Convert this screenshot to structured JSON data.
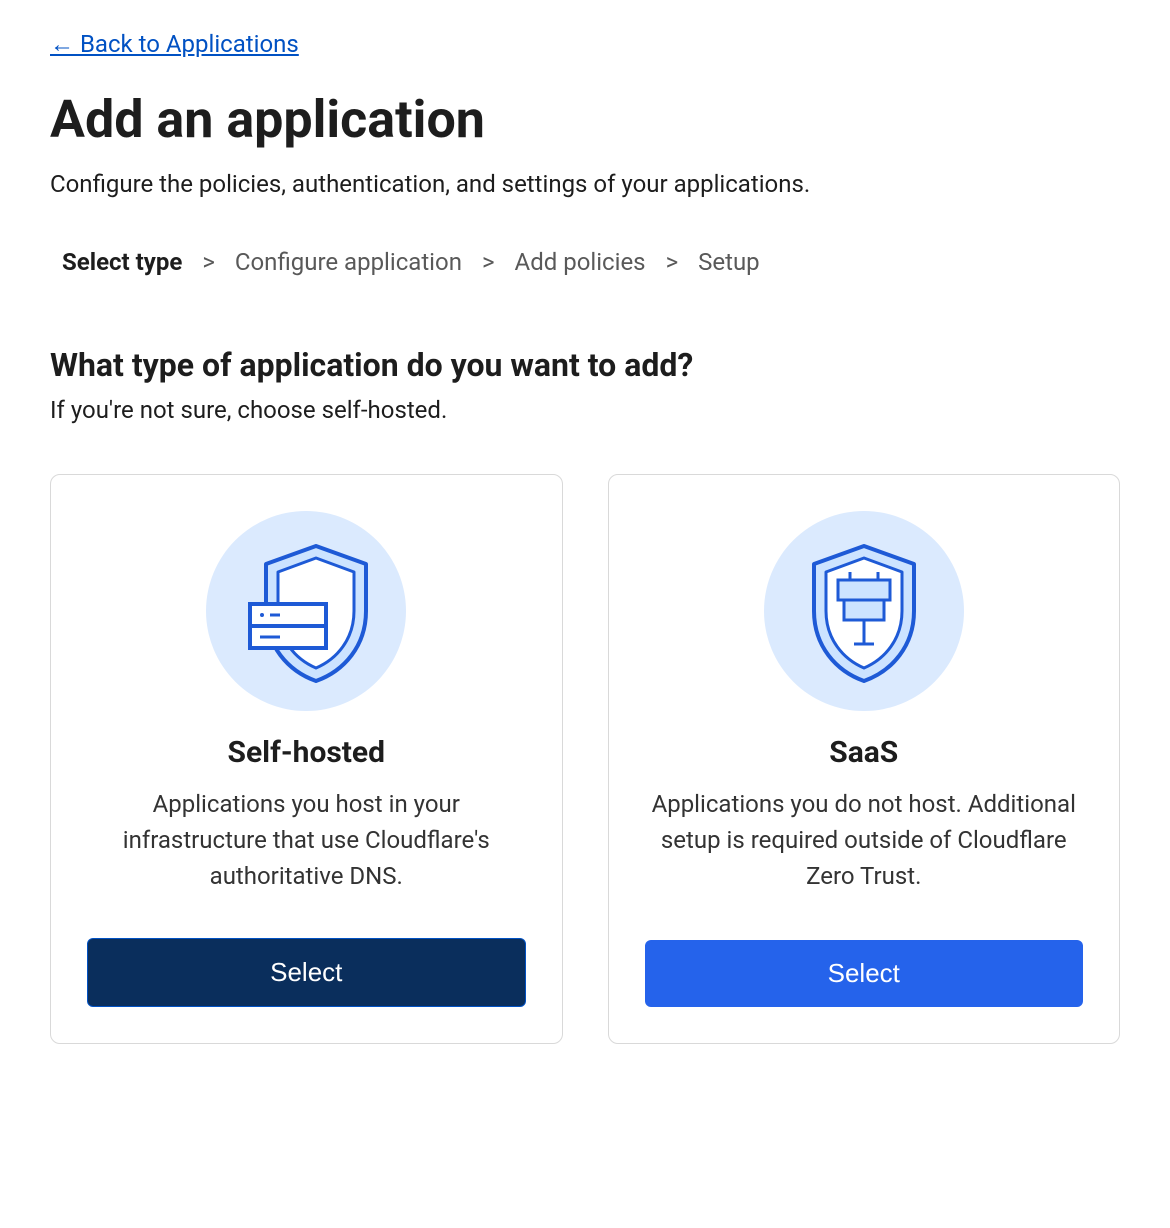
{
  "back_link": "← Back to Applications",
  "page_title": "Add an application",
  "page_subtitle": "Configure the policies, authentication, and settings of your applications.",
  "breadcrumb": {
    "steps": [
      {
        "label": "Select type",
        "active": true
      },
      {
        "label": "Configure application",
        "active": false
      },
      {
        "label": "Add policies",
        "active": false
      },
      {
        "label": "Setup",
        "active": false
      }
    ],
    "separator": ">"
  },
  "section": {
    "title": "What type of application do you want to add?",
    "subtitle": "If you're not sure, choose self-hosted."
  },
  "cards": [
    {
      "icon": "shield-server-icon",
      "title": "Self-hosted",
      "description": "Applications you host in your infrastructure that use Cloudflare's authoritative DNS.",
      "button_label": "Select",
      "button_style": "primary-dark"
    },
    {
      "icon": "shield-wall-icon",
      "title": "SaaS",
      "description": "Applications you do not host. Additional setup is required outside of Cloudflare Zero Trust.",
      "button_label": "Select",
      "button_style": "primary-blue"
    }
  ],
  "colors": {
    "link_blue": "#0051c3",
    "button_blue": "#2563eb",
    "button_dark": "#0a2e5c",
    "icon_bg": "#dbeafe",
    "icon_stroke": "#1e5ad6",
    "icon_fill": "#cce3ff"
  }
}
